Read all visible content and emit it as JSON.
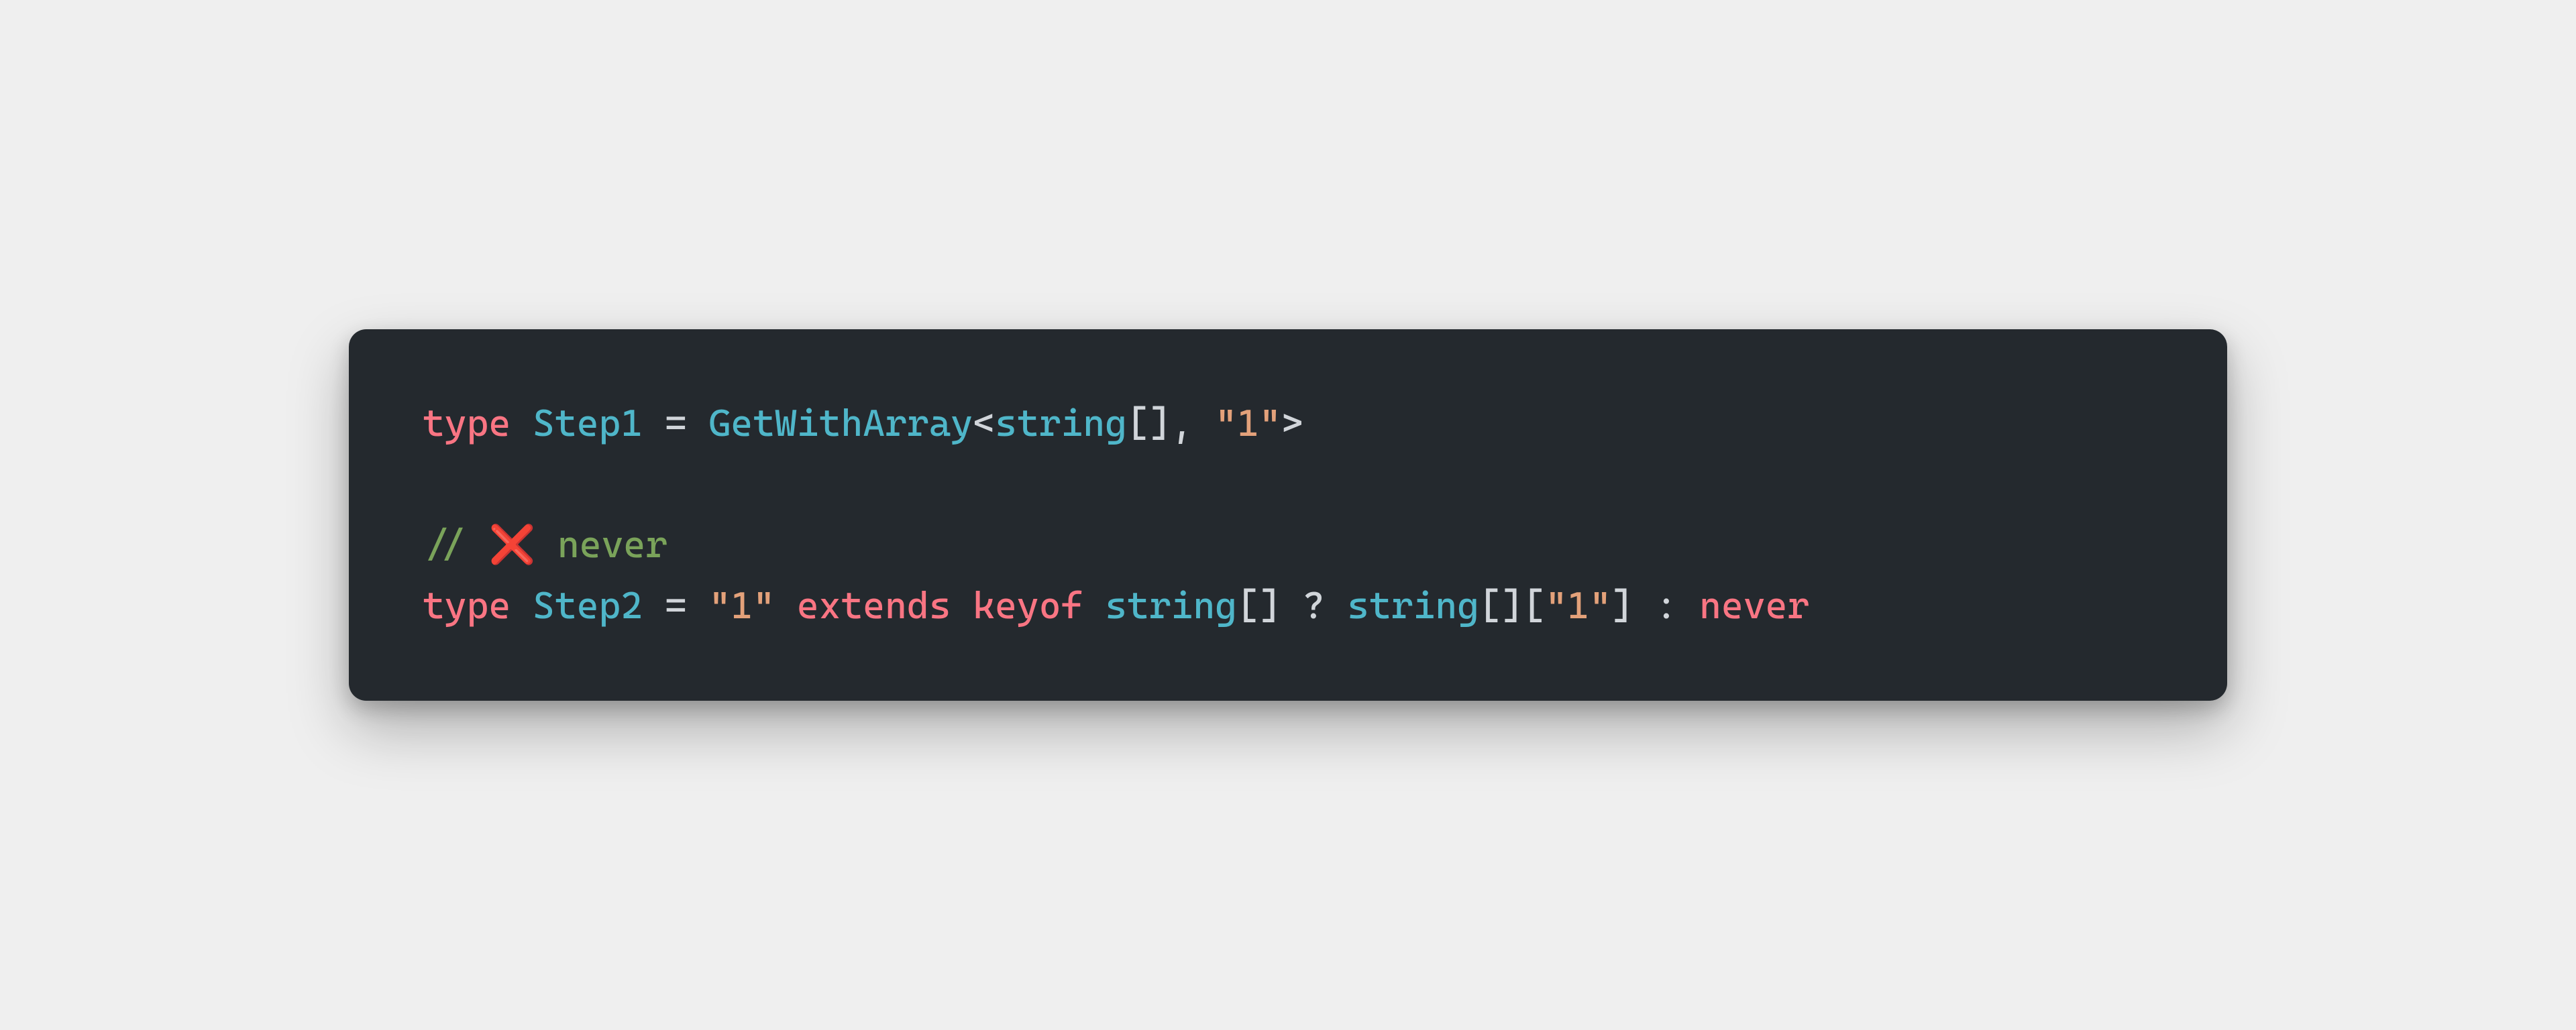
{
  "colors": {
    "bg": "#efefef",
    "card": "#24292e",
    "keyword": "#f97583",
    "type": "#4fb6c9",
    "string": "#e3a17a",
    "punctuation": "#d1d5da",
    "comment": "#7aa35a",
    "emoji": "#e23b3b"
  },
  "code": {
    "line1": {
      "kw_type": "type",
      "name": "Step1",
      "eq": " = ",
      "fn": "GetWithArray",
      "lt": "<",
      "arg1_type": "string",
      "arg1_brackets": "[]",
      "comma": ", ",
      "arg2_str": "\"1\"",
      "gt": ">"
    },
    "line3": {
      "slashes": "// ",
      "emoji": "❌",
      "text": " never"
    },
    "line4": {
      "kw_type": "type",
      "name": "Step2",
      "eq": " = ",
      "str1": "\"1\"",
      "kw_extends": " extends ",
      "kw_keyof": "keyof ",
      "t_string": "string",
      "brk1": "[]",
      "q": " ? ",
      "t_string2": "string",
      "brk2": "[]",
      "lb": "[",
      "str2": "\"1\"",
      "rb": "]",
      "colon": " : ",
      "kw_never": "never"
    }
  }
}
